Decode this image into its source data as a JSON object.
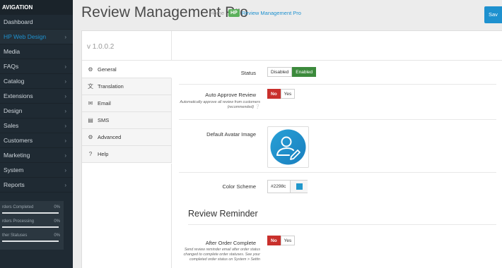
{
  "nav": {
    "heading": "AVIGATION",
    "items": [
      {
        "label": "Dashboard",
        "chevron": false,
        "active": false
      },
      {
        "label": "HP Web Design",
        "chevron": true,
        "active": true
      },
      {
        "label": "Media",
        "chevron": false,
        "active": false
      },
      {
        "label": "FAQs",
        "chevron": true,
        "active": false
      },
      {
        "label": "Catalog",
        "chevron": true,
        "active": false
      },
      {
        "label": "Extensions",
        "chevron": true,
        "active": false
      },
      {
        "label": "Design",
        "chevron": true,
        "active": false
      },
      {
        "label": "Sales",
        "chevron": true,
        "active": false
      },
      {
        "label": "Customers",
        "chevron": true,
        "active": false
      },
      {
        "label": "Marketing",
        "chevron": true,
        "active": false
      },
      {
        "label": "System",
        "chevron": true,
        "active": false
      },
      {
        "label": "Reports",
        "chevron": true,
        "active": false
      }
    ],
    "stats": [
      {
        "label": "rders Completed",
        "value": "0%"
      },
      {
        "label": "rders Processing",
        "value": "0%"
      },
      {
        "label": "ther Statuses",
        "value": "0%"
      }
    ]
  },
  "header": {
    "title": "Review Management Pro",
    "breadcrumb_home": "Home",
    "breadcrumb_logo": "HP",
    "breadcrumb_current": "Review Management Pro",
    "save_label": "Sav"
  },
  "panel": {
    "version": "v 1.0.0.2",
    "tabs": [
      {
        "label": "General",
        "icon": "gear-icon",
        "glyph": "⚙"
      },
      {
        "label": "Translation",
        "icon": "language-icon",
        "glyph": "文"
      },
      {
        "label": "Email",
        "icon": "envelope-icon",
        "glyph": "✉"
      },
      {
        "label": "SMS",
        "icon": "sms-icon",
        "glyph": "▤"
      },
      {
        "label": "Advanced",
        "icon": "gears-icon",
        "glyph": "⚙"
      },
      {
        "label": "Help",
        "icon": "question-circle-icon",
        "glyph": "?"
      }
    ]
  },
  "form": {
    "status_label": "Status",
    "status_disabled": "Disabled",
    "status_enabled": "Enabled",
    "auto_approve_label": "Auto Approve Review",
    "auto_approve_help": "Automatically approve all review from customers (recommended)",
    "no_label": "No",
    "yes_label": "Yes",
    "avatar_label": "Default Avatar Image",
    "color_label": "Color Scheme",
    "color_value": "#2298cc",
    "color_display": "#2298c",
    "section_title": "Review Reminder",
    "after_order_label": "After Order Complete",
    "after_order_help": "Send review reminder email after order status changed to complete order statuses. See your completed order status on System > Settin"
  },
  "colors": {
    "accent": "#1e91cf",
    "enabled": "#3c8a3c",
    "no": "#c9302c",
    "brand_logo": "#5bb05b"
  }
}
